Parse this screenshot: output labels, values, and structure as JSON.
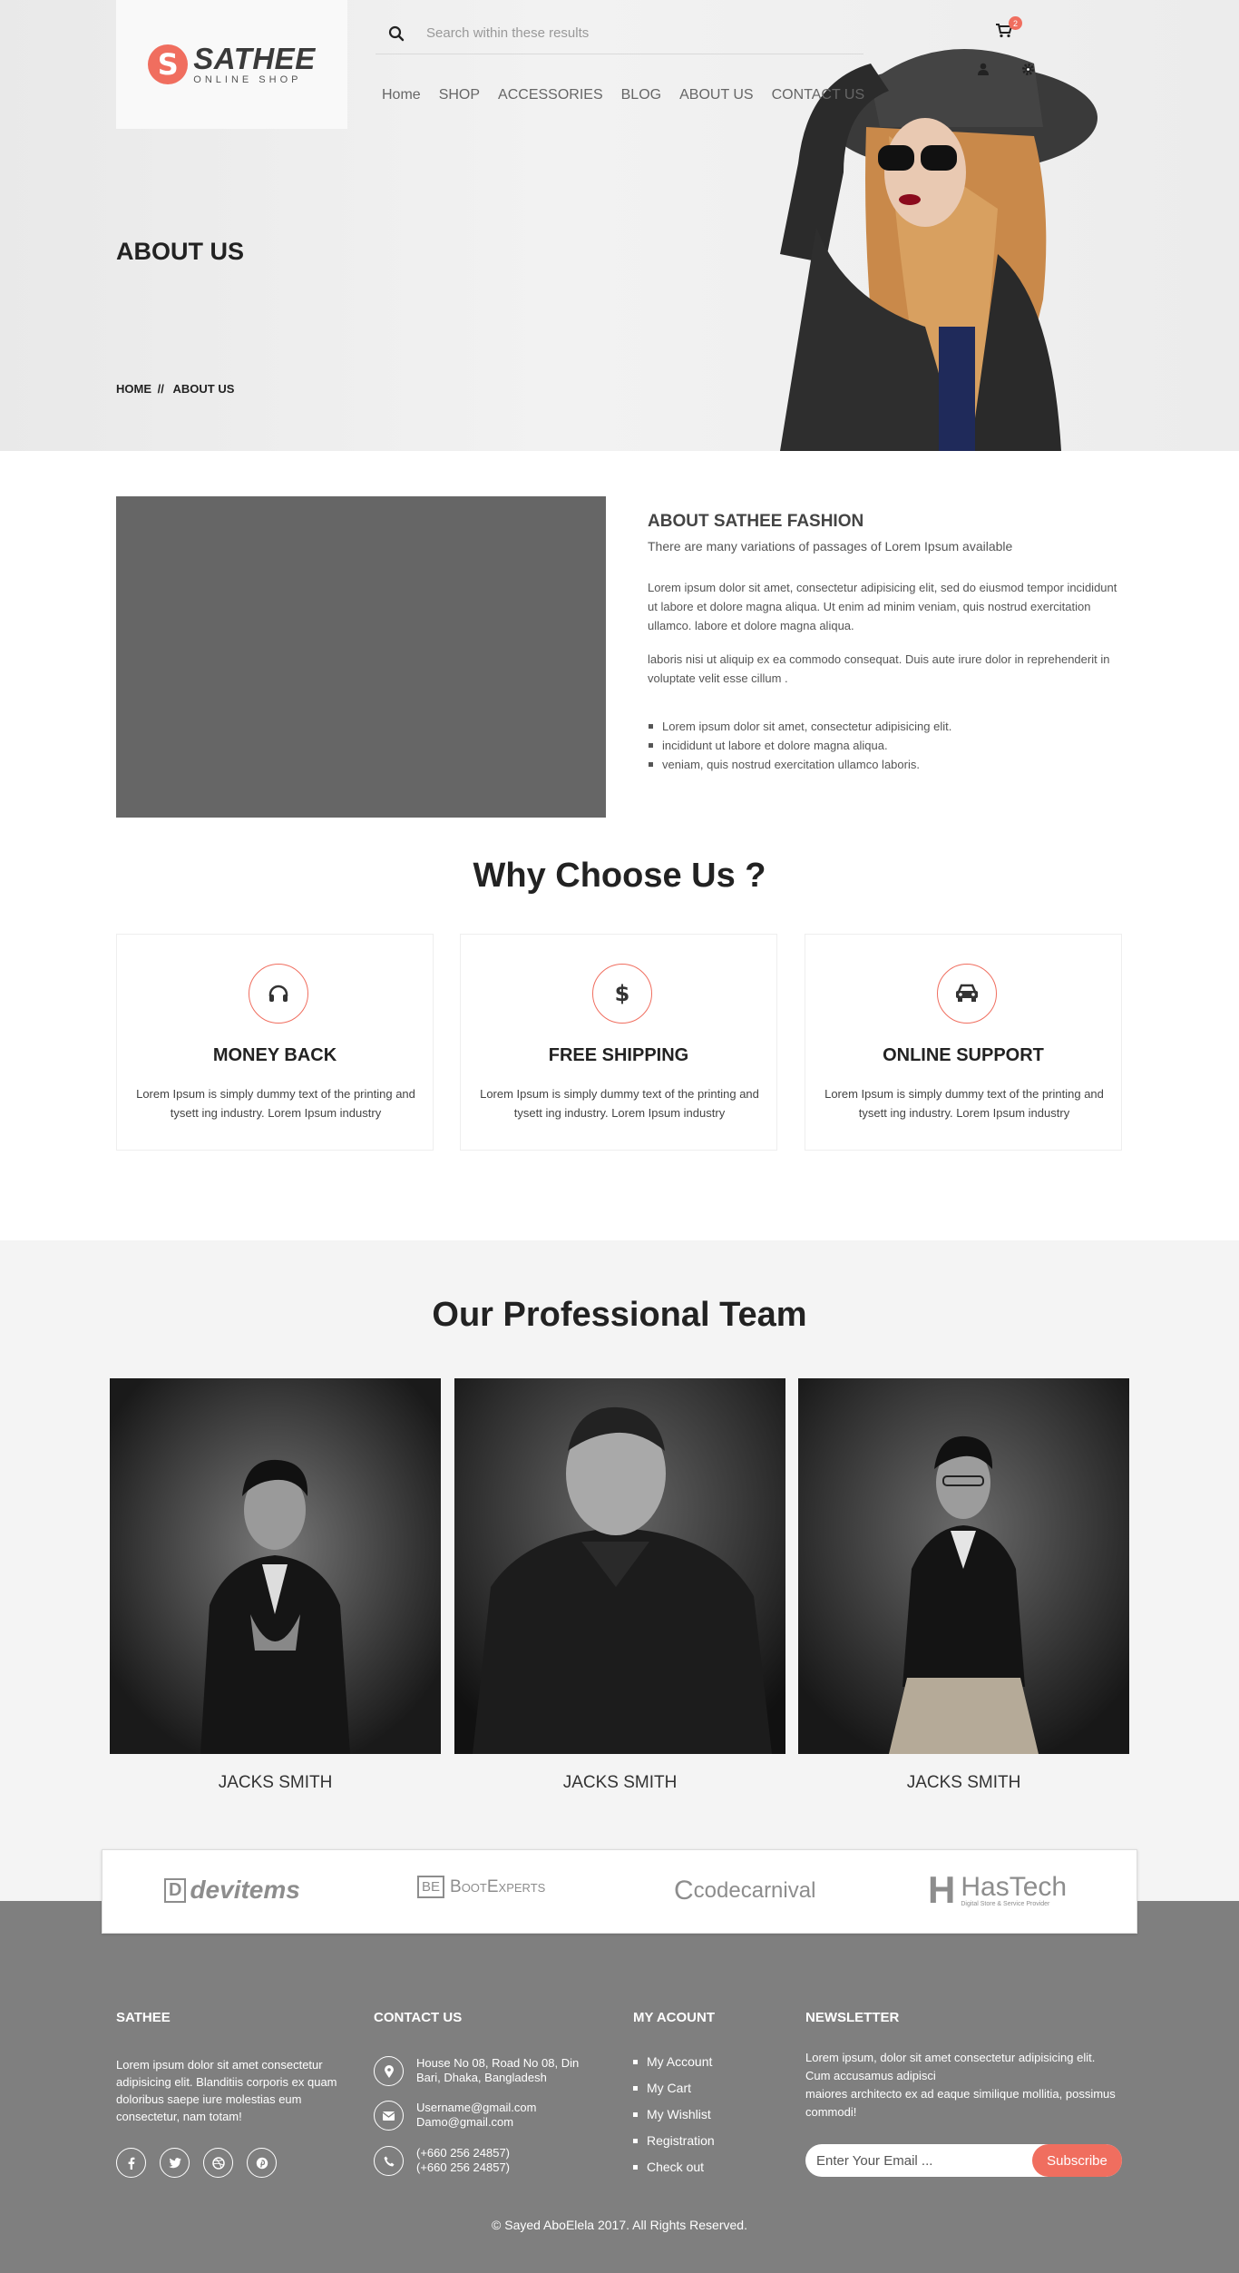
{
  "header": {
    "logo_name": "SATHEE",
    "logo_sub": "ONLINE SHOP",
    "search_placeholder": "Search within these results",
    "cart_count": "2",
    "nav": [
      "Home",
      "SHOP",
      "ACCESSORIES",
      "BLOG",
      "ABOUT US",
      "CONTACT US"
    ]
  },
  "hero": {
    "title": "ABOUT US",
    "breadcrumb": {
      "home": "HOME",
      "sep": "//",
      "current": "ABOUT US"
    }
  },
  "about": {
    "heading": "ABOUT SATHEE FASHION",
    "subheading": "There are many variations of passages of Lorem Ipsum available",
    "p1": "Lorem ipsum dolor sit amet, consectetur adipisicing elit, sed do eiusmod tempor incididunt ut labore et dolore magna aliqua. Ut enim ad minim veniam, quis nostrud exercitation ullamco. labore et dolore magna aliqua.",
    "p2": "laboris nisi ut aliquip ex ea commodo consequat. Duis aute irure dolor in reprehenderit in voluptate velit esse cillum .",
    "list": [
      "Lorem ipsum dolor sit amet, consectetur adipisicing elit.",
      "incididunt ut labore et dolore magna aliqua.",
      "veniam, quis nostrud exercitation ullamco laboris."
    ]
  },
  "why": {
    "title": "Why Choose Us ?",
    "features": [
      {
        "icon": "headphones-icon",
        "title": "MONEY BACK",
        "text": "Lorem Ipsum is simply dummy text of the printing and tysett ing industry. Lorem Ipsum industry"
      },
      {
        "icon": "dollar-icon",
        "title": "FREE SHIPPING",
        "text": "Lorem Ipsum is simply dummy text of the printing and tysett ing industry. Lorem Ipsum industry"
      },
      {
        "icon": "car-icon",
        "title": "ONLINE SUPPORT",
        "text": "Lorem Ipsum is simply dummy text of the printing and tysett ing industry. Lorem Ipsum industry"
      }
    ],
    "accent": "#f06e5f"
  },
  "team": {
    "title": "Our Professional Team",
    "members": [
      {
        "name": "JACKS SMITH"
      },
      {
        "name": "JACKS SMITH"
      },
      {
        "name": "JACKS SMITH"
      }
    ]
  },
  "brands": {
    "items": [
      {
        "name": "devitems",
        "mark": "D"
      },
      {
        "name": "BootExperts",
        "mark": "BE"
      },
      {
        "name": "codecarnival",
        "mark": "C"
      },
      {
        "name": "HasTech",
        "mark": "H",
        "tagline": "Digital Store & Service Provider"
      }
    ]
  },
  "footer": {
    "col1": {
      "heading": "SATHEE",
      "text": "Lorem ipsum dolor sit amet consectetur adipisicing elit. Blanditiis corporis ex quam doloribus saepe iure molestias eum consectetur, nam totam!"
    },
    "col2": {
      "heading": "CONTACT US",
      "address": [
        "House No 08, Road No 08, Din",
        "Bari, Dhaka, Bangladesh"
      ],
      "emails": [
        "Username@gmail.com",
        "Damo@gmail.com"
      ],
      "phones": [
        "(+660 256 24857)",
        "(+660 256 24857)"
      ]
    },
    "col3": {
      "heading": "MY ACOUNT",
      "links": [
        "My Account",
        "My Cart",
        "My Wishlist",
        "Registration",
        "Check out"
      ]
    },
    "col4": {
      "heading": "NEWSLETTER",
      "text": [
        "Lorem ipsum, dolor sit amet consectetur adipisicing elit.",
        "Cum accusamus adipisci",
        "maiores architecto ex ad eaque similique mollitia, possimus commodi!"
      ],
      "placeholder": "Enter Your Email ...",
      "button": "Subscribe"
    },
    "copyright": "© Sayed AboElela 2017. All Rights Reserved.",
    "background": "#7f7f7f"
  }
}
